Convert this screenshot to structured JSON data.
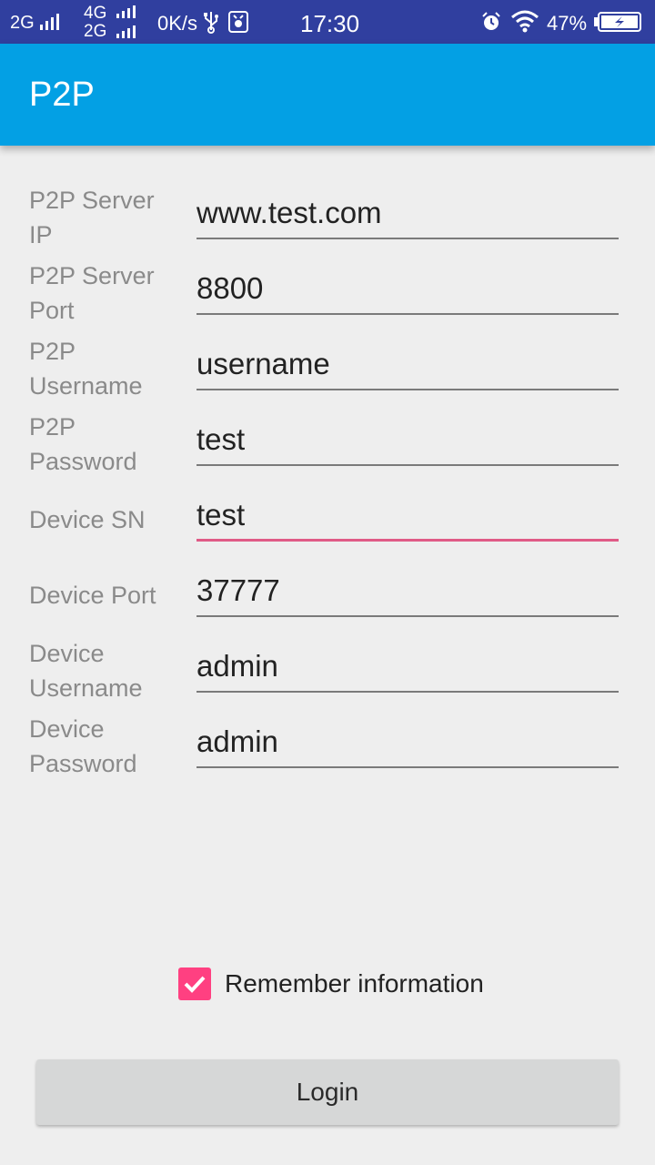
{
  "status_bar": {
    "network_1": "2G",
    "network_2a": "4G",
    "network_2b": "2G",
    "speed": "0K/s",
    "time": "17:30",
    "battery_percent": "47%",
    "battery_level": 0.47,
    "icons": [
      "signal-icon",
      "usb-icon",
      "debug-icon",
      "alarm-icon",
      "wifi-icon",
      "battery-icon"
    ]
  },
  "app_bar": {
    "title": "P2P",
    "color": "#03a0e4"
  },
  "form": {
    "fields": [
      {
        "label": "P2P Server IP",
        "value": "www.test.com"
      },
      {
        "label": "P2P Server Port",
        "value": "8800"
      },
      {
        "label": "P2P Username",
        "value": "username"
      },
      {
        "label": "P2P Password",
        "value": "test"
      },
      {
        "label": "Device SN",
        "value": "test"
      },
      {
        "label": "Device Port",
        "value": "37777"
      },
      {
        "label": "Device Username",
        "value": "admin"
      },
      {
        "label": "Device Password",
        "value": "admin"
      }
    ],
    "focused_field": "Device SN",
    "remember_label": "Remember information",
    "remember_checked": true,
    "accent_color": "#ff4081",
    "login_label": "Login"
  }
}
